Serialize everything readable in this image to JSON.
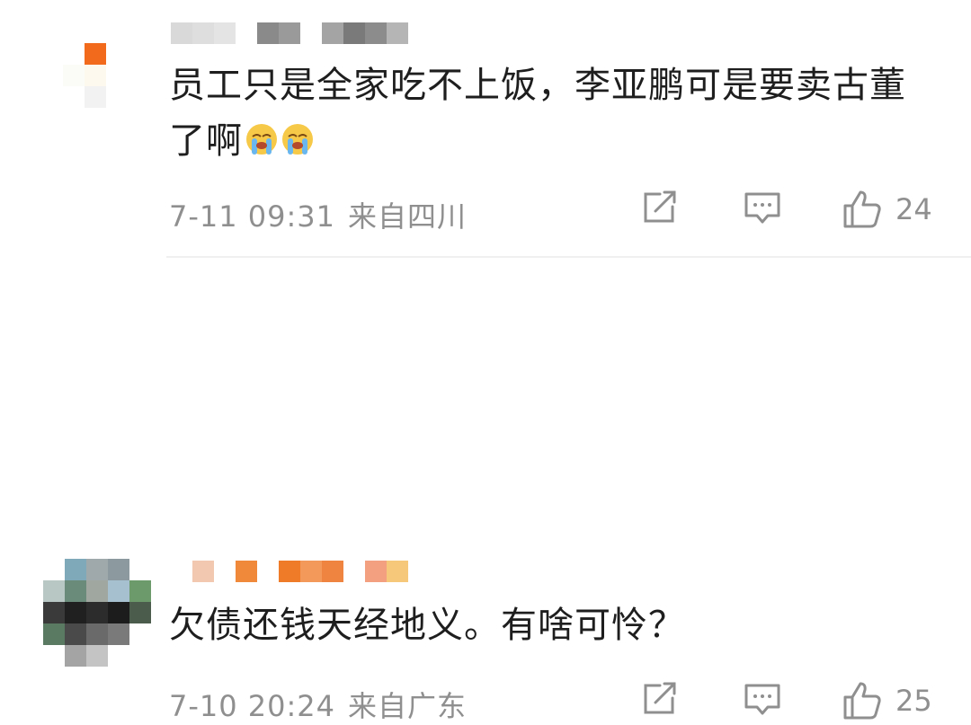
{
  "comments": [
    {
      "text": "员工只是全家吃不上饭，李亚鹏可是要卖古董了啊",
      "emoji": [
        "crying-emoji",
        "crying-emoji"
      ],
      "date": "7-11 09:31",
      "location": "来自四川",
      "likes": "24"
    },
    {
      "text": "欠债还钱天经地义。有啥可怜？",
      "date": "7-10 20:24",
      "location": "来自广东",
      "likes": "25"
    }
  ],
  "icons": {
    "share": "share-icon",
    "reply": "comment-icon",
    "like": "thumbs-up-icon"
  },
  "colors": {
    "text": "#1e1e1e",
    "meta": "#8f8f8f",
    "divider": "#f0f0f0"
  }
}
